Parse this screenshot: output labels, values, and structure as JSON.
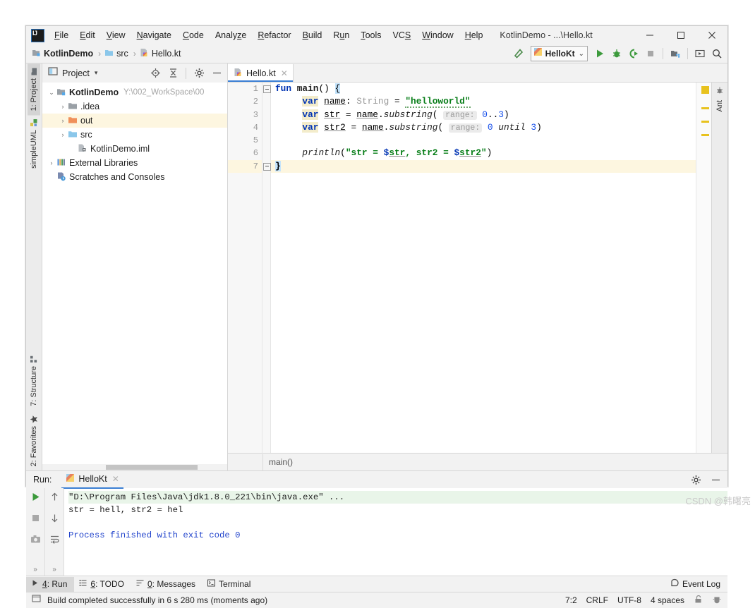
{
  "window": {
    "title": "KotlinDemo - ...\\Hello.kt",
    "minimize": "–",
    "maximize": "□",
    "close": "✕"
  },
  "menu": {
    "items": [
      {
        "label": "File",
        "mnemonic": "F"
      },
      {
        "label": "Edit",
        "mnemonic": "E"
      },
      {
        "label": "View",
        "mnemonic": "V"
      },
      {
        "label": "Navigate",
        "mnemonic": "N"
      },
      {
        "label": "Code",
        "mnemonic": "C"
      },
      {
        "label": "Analyze",
        "mnemonic": "z"
      },
      {
        "label": "Refactor",
        "mnemonic": "R"
      },
      {
        "label": "Build",
        "mnemonic": "B"
      },
      {
        "label": "Run",
        "mnemonic": "u"
      },
      {
        "label": "Tools",
        "mnemonic": "T"
      },
      {
        "label": "VCS",
        "mnemonic": "S"
      },
      {
        "label": "Window",
        "mnemonic": "W"
      },
      {
        "label": "Help",
        "mnemonic": "H"
      }
    ]
  },
  "navbar": {
    "crumbs": [
      {
        "label": "KotlinDemo",
        "icon": "module-icon",
        "bold": true
      },
      {
        "label": "src",
        "icon": "folder-icon",
        "bold": false
      },
      {
        "label": "Hello.kt",
        "icon": "kotlin-file-icon",
        "bold": false
      }
    ],
    "separator": "›",
    "run_config": "HelloKt",
    "run_config_caret": "⌄"
  },
  "left_tool_tabs": [
    {
      "label": "1: Project",
      "mnemonic": "1",
      "active": true
    },
    {
      "label": "simpleUML",
      "mnemonic": "",
      "active": false
    },
    {
      "label": "7: Structure",
      "mnemonic": "7",
      "active": false
    },
    {
      "label": "2: Favorites",
      "mnemonic": "2",
      "active": false
    }
  ],
  "right_tool_tabs": [
    {
      "label": "Ant"
    }
  ],
  "project_panel": {
    "title": "Project",
    "caret": "▾",
    "tree": [
      {
        "label": "KotlinDemo",
        "path": "Y:\\002_WorkSpace\\00",
        "arrow": "⌄",
        "depth": 0,
        "bold": true,
        "icon": "module-icon",
        "highlight": false
      },
      {
        "label": ".idea",
        "path": "",
        "arrow": "›",
        "depth": 1,
        "bold": false,
        "icon": "folder-gray-icon",
        "highlight": false
      },
      {
        "label": "out",
        "path": "",
        "arrow": "›",
        "depth": 1,
        "bold": false,
        "icon": "folder-orange-icon",
        "highlight": true
      },
      {
        "label": "src",
        "path": "",
        "arrow": "›",
        "depth": 1,
        "bold": false,
        "icon": "folder-blue-icon",
        "highlight": false
      },
      {
        "label": "KotlinDemo.iml",
        "path": "",
        "arrow": "",
        "depth": 2,
        "bold": false,
        "icon": "iml-file-icon",
        "highlight": false
      },
      {
        "label": "External Libraries",
        "path": "",
        "arrow": "›",
        "depth": 0,
        "bold": false,
        "icon": "libraries-icon",
        "highlight": false
      },
      {
        "label": "Scratches and Consoles",
        "path": "",
        "arrow": "",
        "depth": 0,
        "bold": false,
        "icon": "scratches-icon",
        "highlight": false
      }
    ]
  },
  "editor": {
    "tab_label": "Hello.kt",
    "tab_close": "✕",
    "line_numbers": [
      "1",
      "2",
      "3",
      "4",
      "5",
      "6",
      "7"
    ],
    "breadcrumb": "main()",
    "code_lines": [
      {
        "n": 1,
        "text": "fun main() {"
      },
      {
        "n": 2,
        "text": "    var name: String = \"helloworld\""
      },
      {
        "n": 3,
        "text": "    var str = name.substring( range: 0..3)"
      },
      {
        "n": 4,
        "text": "    var str2 = name.substring( range: 0 until 3)"
      },
      {
        "n": 5,
        "text": ""
      },
      {
        "n": 6,
        "text": "    println(\"str = $str, str2 = $str2\")"
      },
      {
        "n": 7,
        "text": "}"
      }
    ],
    "inlay_hints": [
      "range:",
      "range:"
    ]
  },
  "run_window": {
    "label": "Run:",
    "tab": "HelloKt",
    "tab_close": "✕",
    "console": [
      {
        "text": "\"D:\\Program Files\\Java\\jdk1.8.0_221\\bin\\java.exe\" ...",
        "style": "cmd"
      },
      {
        "text": "str = hell, str2 = hel",
        "style": "plain"
      },
      {
        "text": "",
        "style": "plain"
      },
      {
        "text": "Process finished with exit code 0",
        "style": "link"
      }
    ],
    "chevron": "»"
  },
  "bottom_tabs": [
    {
      "label": "4: Run",
      "mnemonic": "4",
      "icon": "run-icon",
      "active": true
    },
    {
      "label": "6: TODO",
      "mnemonic": "6",
      "icon": "todo-icon",
      "active": false
    },
    {
      "label": "0: Messages",
      "mnemonic": "0",
      "icon": "messages-icon",
      "active": false
    },
    {
      "label": "Terminal",
      "mnemonic": "",
      "icon": "terminal-icon",
      "active": false
    }
  ],
  "event_log": "Event Log",
  "status_bar": {
    "message": "Build completed successfully in 6 s 280 ms (moments ago)",
    "caret_position": "7:2",
    "line_separator": "CRLF",
    "encoding": "UTF-8",
    "indent": "4 spaces"
  },
  "watermark": "CSDN @韩曙亮",
  "colors": {
    "accent_blue": "#3b7fd4",
    "keyword": "#0033b3",
    "string": "#067d17",
    "number": "#1750eb",
    "warning_marker": "#e8c21e",
    "run_green": "#3c9a3c",
    "highlight_row": "#fdf6e0"
  }
}
